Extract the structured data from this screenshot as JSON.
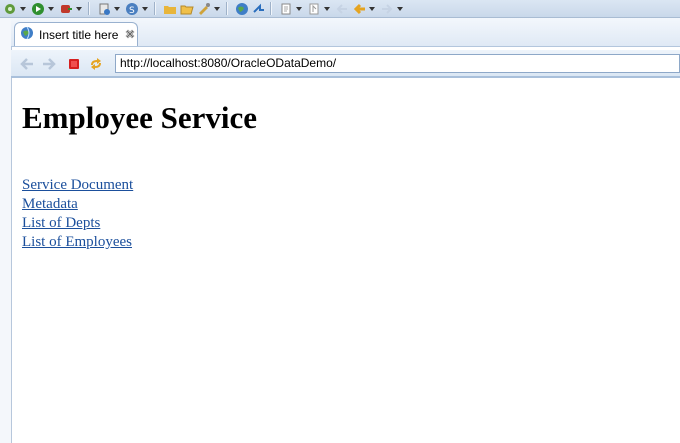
{
  "tab": {
    "title": "Insert title here",
    "close_icon": "close-icon"
  },
  "address": {
    "url": "http://localhost:8080/OracleODataDemo/"
  },
  "page": {
    "heading": "Employee Service",
    "links": [
      {
        "label": "Service Document"
      },
      {
        "label": "Metadata"
      },
      {
        "label": "List of Depts"
      },
      {
        "label": "List of Employees"
      }
    ]
  },
  "toolbar_icons": [
    "debug-icon",
    "run-icon",
    "external-tools-icon",
    "new-server-icon",
    "web-service-icon",
    "open-folder-icon",
    "open-file-icon",
    "build-icon",
    "globe-icon",
    "navigate-icon",
    "edit-icon",
    "next-annotation-icon",
    "back-icon",
    "forward-icon"
  ],
  "colors": {
    "link": "#1b4f9c",
    "chrome": "#c9d8ea"
  }
}
